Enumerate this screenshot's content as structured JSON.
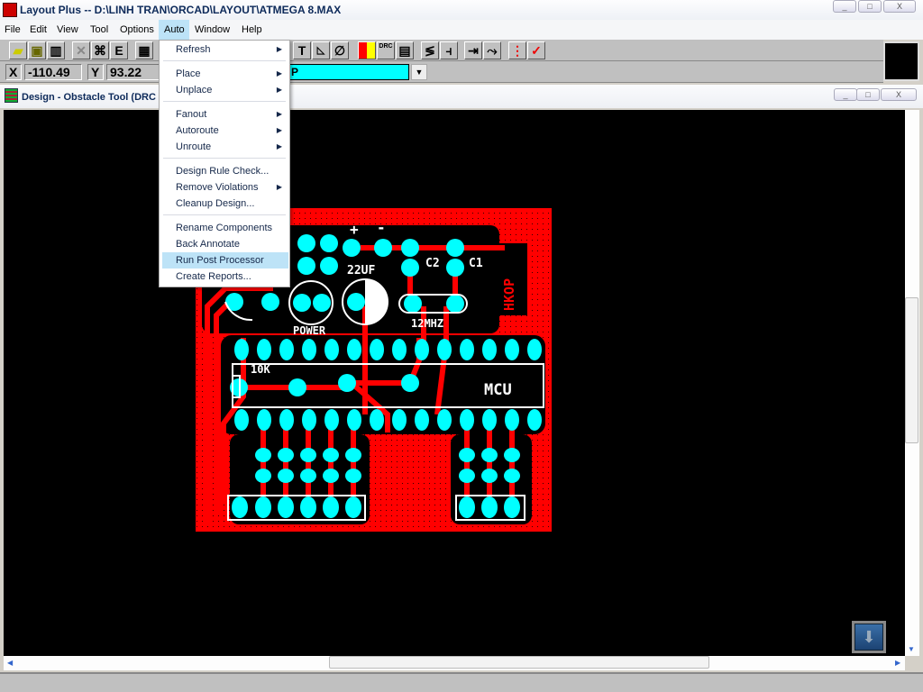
{
  "window": {
    "title": "Layout Plus -- D:\\LINH TRAN\\ORCAD\\LAYOUT\\ATMEGA 8.MAX"
  },
  "menubar": [
    "File",
    "Edit",
    "View",
    "Tool",
    "Options",
    "Auto",
    "Window",
    "Help"
  ],
  "auto_menu": [
    {
      "label": "Refresh",
      "submenu": true
    },
    {
      "label": "Place",
      "submenu": true
    },
    {
      "label": "Unplace",
      "submenu": true
    },
    {
      "label": "Fanout",
      "submenu": true
    },
    {
      "label": "Autoroute",
      "submenu": true
    },
    {
      "label": "Unroute",
      "submenu": true
    },
    {
      "label": "Design Rule Check...",
      "submenu": false
    },
    {
      "label": "Remove Violations",
      "submenu": true
    },
    {
      "label": "Cleanup Design...",
      "submenu": false
    },
    {
      "label": "Rename Components",
      "submenu": false
    },
    {
      "label": "Back Annotate",
      "submenu": false
    },
    {
      "label": "Run Post Processor",
      "submenu": false,
      "highlighted": true
    },
    {
      "label": "Create Reports...",
      "submenu": false
    }
  ],
  "coords": {
    "x_label": "X",
    "x": "-110.49",
    "y_label": "Y",
    "y": "93.22"
  },
  "layer": {
    "value": "P",
    "color": "#00ffff"
  },
  "toolbar": {
    "e_label": "E",
    "t_label": "T",
    "drc_label": "DRC"
  },
  "child_window": {
    "title": "Design - Obstacle Tool (DRC"
  },
  "pcb": {
    "labels": {
      "cap": "22UF",
      "c2": "C2",
      "c1": "C1",
      "power": "POWER",
      "crystal": "12MHZ",
      "resistor": "10K",
      "mcu": "MCU",
      "hkop": "HKOP",
      "plus": "+",
      "minus": "-"
    },
    "colors": {
      "board": "#ff0000",
      "pad": "#00ffff",
      "silk": "#ffffff",
      "background": "#000000"
    }
  }
}
